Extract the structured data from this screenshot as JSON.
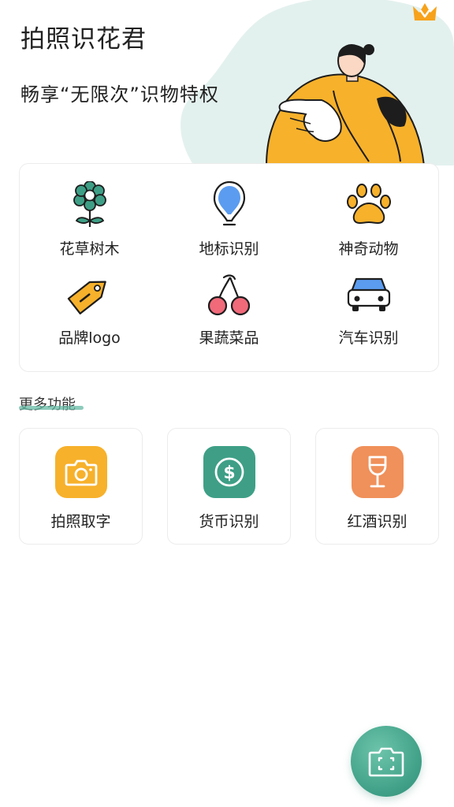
{
  "app": {
    "title": "拍照识花君",
    "slogan": "畅享“无限次”识物特权",
    "vip_icon": "crown-icon"
  },
  "colors": {
    "accent": "#3e9f86",
    "orange": "#f7b12b",
    "blob": "#e3f1ee"
  },
  "features": [
    {
      "label": "花草树木",
      "icon": "flower-icon"
    },
    {
      "label": "地标识别",
      "icon": "location-pin-icon"
    },
    {
      "label": "神奇动物",
      "icon": "paw-icon"
    },
    {
      "label": "品牌logo",
      "icon": "tag-icon"
    },
    {
      "label": "果蔬菜品",
      "icon": "cherry-icon"
    },
    {
      "label": "汽车识别",
      "icon": "car-icon"
    }
  ],
  "more": {
    "title": "更多功能",
    "items": [
      {
        "label": "拍照取字",
        "icon": "camera-icon",
        "color": "#f7b12b"
      },
      {
        "label": "货币识别",
        "icon": "coin-icon",
        "color": "#3e9f86"
      },
      {
        "label": "红酒识别",
        "icon": "wine-glass-icon",
        "color": "#f0905a"
      }
    ]
  },
  "fab": {
    "icon": "scan-camera-icon"
  }
}
